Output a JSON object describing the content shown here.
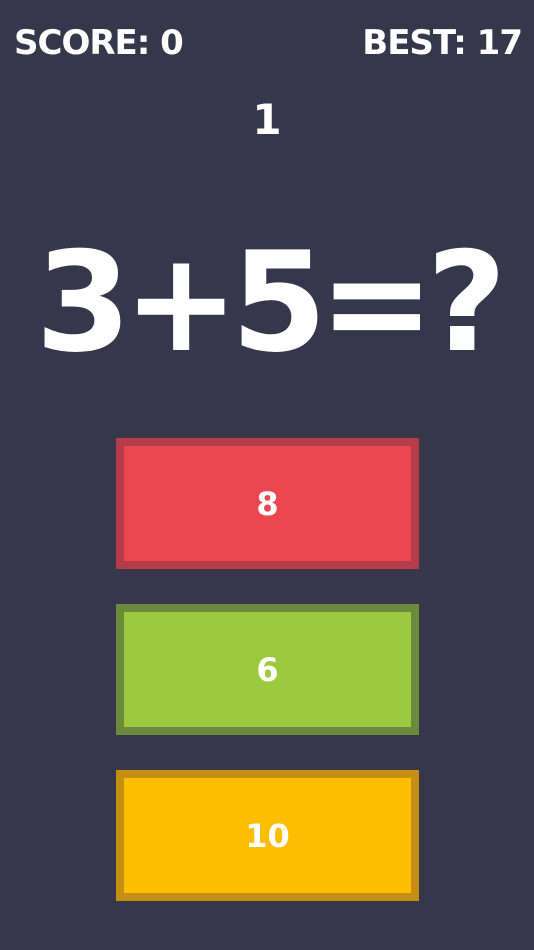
{
  "hud": {
    "score_text": "SCORE: 0",
    "best_text": "BEST: 17"
  },
  "timer": "1",
  "question": "3+5=?",
  "answers": [
    {
      "label": "8",
      "fill": "#ec4650",
      "border": "#b63c4a"
    },
    {
      "label": "6",
      "fill": "#9bca3e",
      "border": "#6b8b3c"
    },
    {
      "label": "10",
      "fill": "#fdbd00",
      "border": "#c68f14"
    }
  ],
  "colors": {
    "background": "#37374b",
    "text": "#ffffff"
  }
}
